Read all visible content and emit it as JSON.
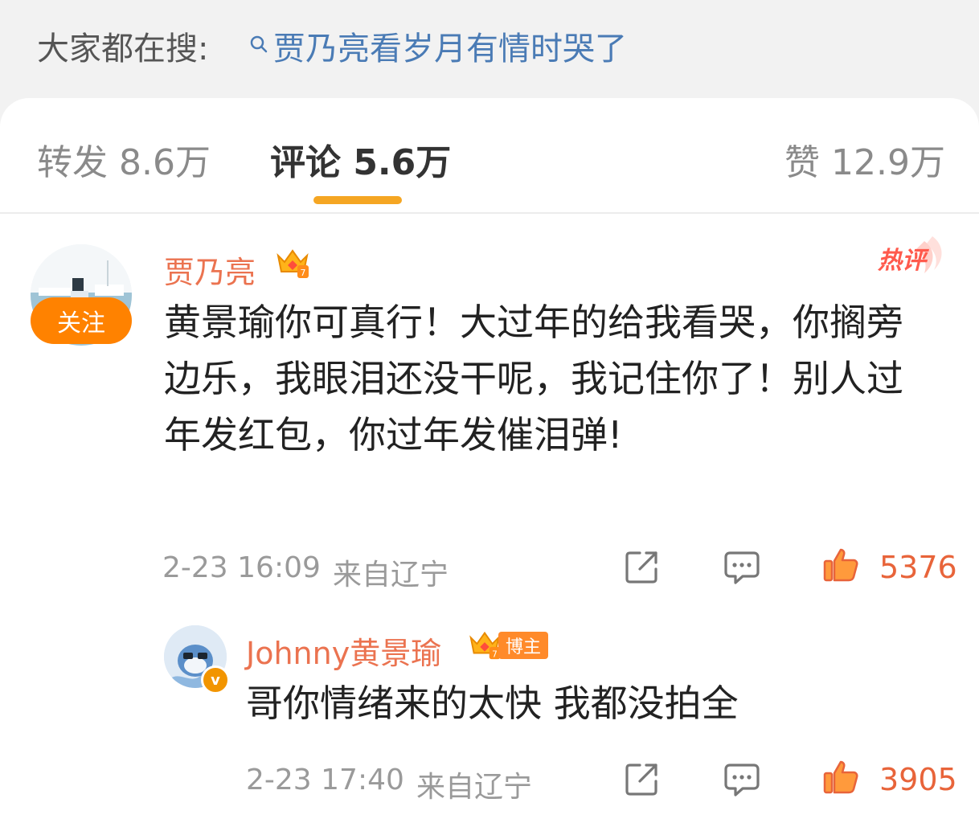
{
  "search": {
    "prefix": "大家都在搜:",
    "query": "贾乃亮看岁月有情时哭了"
  },
  "tabs": {
    "repost": "转发 8.6万",
    "comments": "评论 5.6万",
    "likes": "赞 12.9万"
  },
  "comments": [
    {
      "username": "贾乃亮",
      "follow_label": "关注",
      "hot_label": "热评",
      "text": "黄景瑜你可真行！大过年的给我看哭，你搁旁边乐，我眼泪还没干呢，我记住你了！别人过年发红包，你过年发催泪弹!",
      "time": "2-23 16:09",
      "location": "来自辽宁",
      "likes": "5376"
    }
  ],
  "reply": {
    "username": "Johnny黄景瑜",
    "badge_label": "博主",
    "verify_label": "v",
    "text": "哥你情绪来的太快 我都没拍全",
    "time": "2-23 17:40",
    "location": "来自辽宁",
    "likes": "3905"
  },
  "colors": {
    "accent": "#ff8200",
    "username": "#eb7350",
    "like": "#e8643a",
    "link": "#4a7bb5",
    "tab_indicator": "#f5a623"
  },
  "icons": [
    "search-icon",
    "crown-badge-icon",
    "hot-comment-icon",
    "share-icon",
    "comment-icon",
    "like-icon"
  ]
}
